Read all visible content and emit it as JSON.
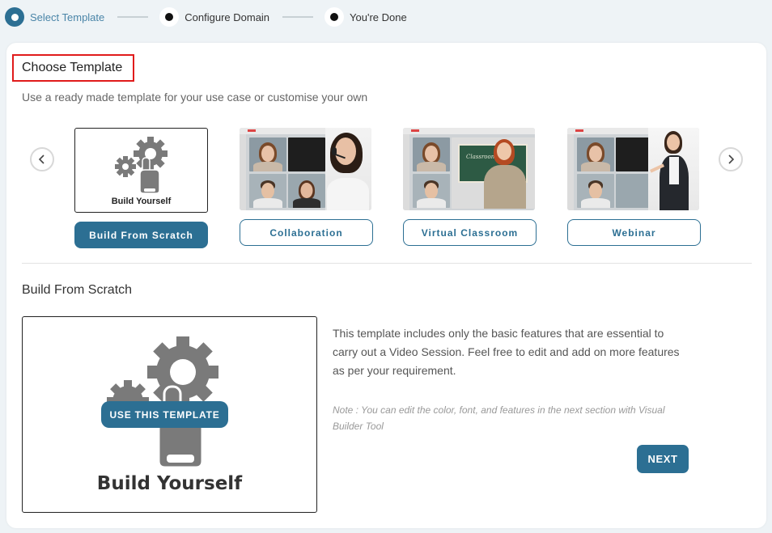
{
  "stepper": {
    "steps": [
      {
        "label": "Select Template",
        "state": "active"
      },
      {
        "label": "Configure Domain",
        "state": "pending"
      },
      {
        "label": "You're Done",
        "state": "pending"
      }
    ]
  },
  "header": {
    "title": "Choose Template",
    "subtitle": "Use a ready made template for your use case or customise your own"
  },
  "carousel": {
    "prev_icon": "chevron-left-icon",
    "next_icon": "chevron-right-icon",
    "templates": [
      {
        "button_label": "Build From Scratch",
        "thumb_caption": "Build Yourself",
        "selected": true
      },
      {
        "button_label": "Collaboration",
        "selected": false
      },
      {
        "button_label": "Virtual Classroom",
        "selected": false,
        "board_text": "Classroom"
      },
      {
        "button_label": "Webinar",
        "selected": false
      }
    ]
  },
  "detail": {
    "section_title": "Build From Scratch",
    "preview_caption": "Build Yourself",
    "use_button_label": "USE THIS TEMPLATE",
    "description": "This template includes only the basic features that are essential to carry out a Video Session. Feel free to edit and add on more features as per your requirement.",
    "note": "Note : You can edit the color, font, and features in the next section with Visual Builder Tool",
    "next_label": "NEXT"
  },
  "colors": {
    "primary": "#2c6f93",
    "highlight_border": "#e01b1b",
    "background": "#eef3f6"
  }
}
